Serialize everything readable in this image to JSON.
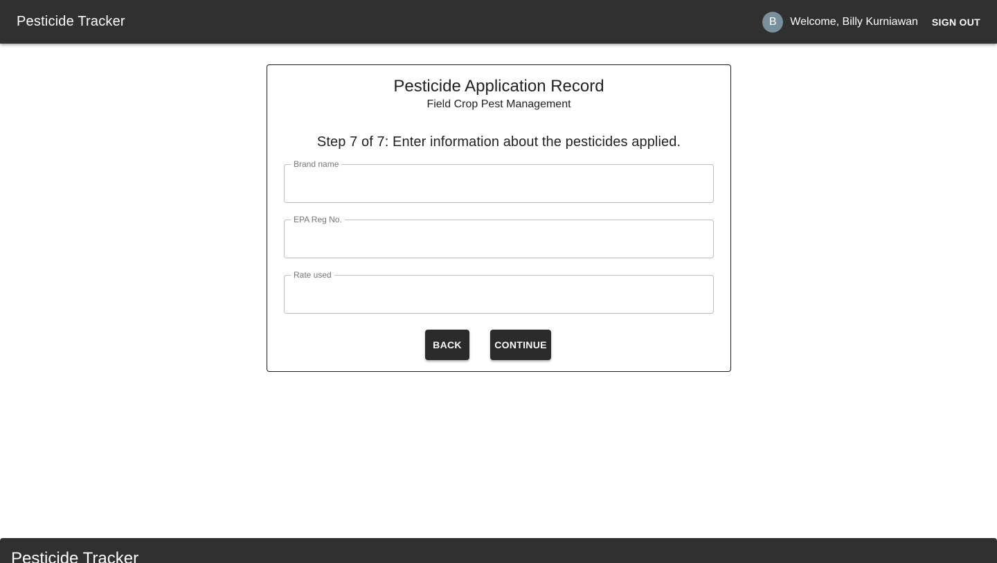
{
  "header": {
    "app_title": "Pesticide Tracker",
    "avatar_initial": "B",
    "welcome_text": "Welcome, Billy Kurniawan",
    "sign_out_label": "SIGN OUT"
  },
  "form": {
    "title": "Pesticide Application Record",
    "subtitle": "Field Crop Pest Management",
    "step_text": "Step 7 of 7: Enter information about the pesticides applied.",
    "fields": {
      "brand_name": {
        "label": "Brand name",
        "value": ""
      },
      "epa_reg_no": {
        "label": "EPA Reg No.",
        "value": ""
      },
      "rate_used": {
        "label": "Rate used",
        "value": ""
      }
    },
    "back_label": "BACK",
    "continue_label": "CONTINUE"
  },
  "footer": {
    "title": "Pesticide Tracker"
  },
  "colors": {
    "appbar": "#303030",
    "avatar": "#78909c",
    "button": "#2b2b2b"
  }
}
